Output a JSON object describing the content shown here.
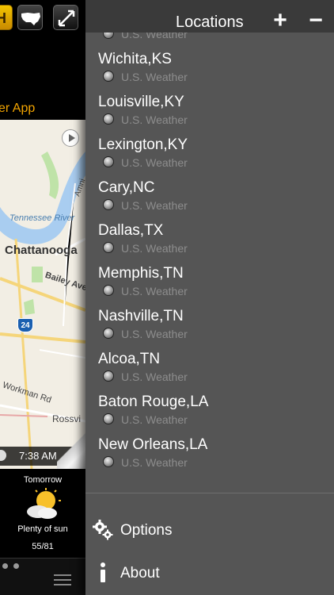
{
  "background_app": {
    "banner_text": "er App",
    "map": {
      "labels": {
        "river": "Tennessee River",
        "city": "Chattanooga",
        "street1": "Bailey Ave",
        "street2": "Amni",
        "street3": "Workman Rd",
        "place": "Rossvi",
        "interstate": "24"
      },
      "time": "7:38 AM"
    },
    "forecast": {
      "day": "Tomorrow",
      "icon": "partly-sunny-icon",
      "description": "Plenty of sun",
      "temps": "55/81"
    }
  },
  "panel": {
    "title": "Locations",
    "add_label": "+",
    "remove_label": "−",
    "locations": [
      {
        "name": "",
        "source": "U.S. Weather"
      },
      {
        "name": "Wichita,KS",
        "source": "U.S. Weather"
      },
      {
        "name": "Louisville,KY",
        "source": "U.S. Weather"
      },
      {
        "name": "Lexington,KY",
        "source": "U.S. Weather"
      },
      {
        "name": "Cary,NC",
        "source": "U.S. Weather"
      },
      {
        "name": "Dallas,TX",
        "source": "U.S. Weather"
      },
      {
        "name": "Memphis,TN",
        "source": "U.S. Weather"
      },
      {
        "name": "Nashville,TN",
        "source": "U.S. Weather"
      },
      {
        "name": "Alcoa,TN",
        "source": "U.S. Weather"
      },
      {
        "name": "Baton Rouge,LA",
        "source": "U.S. Weather"
      },
      {
        "name": "New Orleans,LA",
        "source": "U.S. Weather"
      }
    ],
    "menu": {
      "options": "Options",
      "about": "About"
    }
  },
  "colors": {
    "panel_bg": "#555555",
    "header_bg": "#3a3a3a",
    "accent_orange": "#f2a400",
    "subtext_gray": "#8d8d8d"
  }
}
